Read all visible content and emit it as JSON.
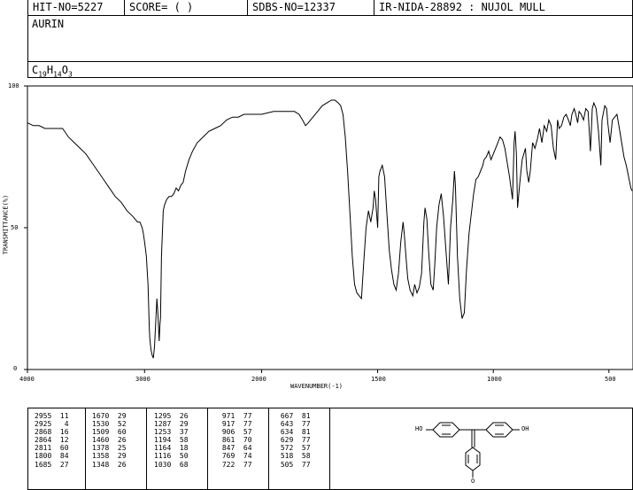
{
  "header": {
    "hit_no": "HIT-NO=5227",
    "score": "SCORE=  (  )",
    "sdbs_no": "SDBS-NO=12337",
    "ir_nida": "IR-NIDA-28892 : NUJOL MULL"
  },
  "compound_name": "AURIN",
  "formula": {
    "c": "C",
    "c_n": "19",
    "h": "H",
    "h_n": "14",
    "o": "O",
    "o_n": "3"
  },
  "chart_data": {
    "type": "line",
    "xlabel": "WAVENUMBER(-1)",
    "ylabel": "TRANSMITTANCE(%)",
    "xlim": [
      4000,
      400
    ],
    "ylim": [
      0,
      100
    ],
    "x_ticks": [
      "4000",
      "3000",
      "2000",
      "1500",
      "1000",
      "500"
    ],
    "y_ticks": [
      "100",
      "50",
      "0"
    ],
    "series": [
      {
        "x": [
          4000,
          3950,
          3900,
          3850,
          3800,
          3750,
          3700,
          3650,
          3600,
          3550,
          3500,
          3450,
          3400,
          3350,
          3300,
          3250,
          3200,
          3150,
          3100,
          3080,
          3060,
          3040,
          3030,
          3020,
          3010,
          3000,
          2985,
          2970,
          2960,
          2955,
          2945,
          2935,
          2925,
          2915,
          2905,
          2895,
          2885,
          2875,
          2868,
          2864,
          2855,
          2840,
          2830,
          2811,
          2790,
          2770,
          2750,
          2730,
          2710,
          2690,
          2670,
          2650,
          2620,
          2590,
          2550,
          2500,
          2450,
          2400,
          2350,
          2300,
          2250,
          2200,
          2150,
          2100,
          2050,
          2000,
          1950,
          1900,
          1860,
          1840,
          1825,
          1812,
          1800,
          1780,
          1760,
          1740,
          1720,
          1700,
          1685,
          1670,
          1660,
          1650,
          1640,
          1630,
          1620,
          1610,
          1600,
          1590,
          1580,
          1570,
          1560,
          1550,
          1540,
          1530,
          1520,
          1515,
          1509,
          1500,
          1495,
          1490,
          1480,
          1470,
          1460,
          1450,
          1440,
          1430,
          1420,
          1410,
          1400,
          1390,
          1385,
          1378,
          1370,
          1360,
          1348,
          1340,
          1330,
          1320,
          1310,
          1300,
          1295,
          1287,
          1280,
          1270,
          1260,
          1253,
          1245,
          1235,
          1225,
          1215,
          1205,
          1194,
          1185,
          1175,
          1168,
          1164,
          1155,
          1145,
          1135,
          1125,
          1116,
          1105,
          1095,
          1085,
          1075,
          1065,
          1055,
          1045,
          1040,
          1030,
          1020,
          1010,
          1000,
          990,
          980,
          971,
          960,
          950,
          940,
          930,
          917,
          910,
          906,
          900,
          895,
          885,
          875,
          861,
          855,
          847,
          840,
          830,
          820,
          810,
          800,
          790,
          780,
          769,
          760,
          750,
          740,
          730,
          722,
          715,
          705,
          695,
          685,
          675,
          667,
          660,
          650,
          643,
          635,
          629,
          620,
          610,
          600,
          590,
          580,
          575,
          572,
          565,
          555,
          545,
          535,
          530,
          518,
          510,
          505,
          495,
          485,
          475,
          465,
          455,
          445,
          435,
          425,
          415,
          405,
          400
        ],
        "y": [
          87,
          86,
          86,
          85,
          85,
          85,
          85,
          82,
          80,
          78,
          76,
          73,
          70,
          67,
          64,
          61,
          59,
          56,
          54,
          53,
          52,
          52,
          51,
          50,
          48,
          45,
          40,
          30,
          15,
          11,
          7,
          5,
          4,
          8,
          16,
          25,
          19,
          10,
          16,
          18,
          40,
          56,
          58,
          60,
          61,
          61,
          62,
          64,
          63,
          65,
          66,
          70,
          74,
          77,
          80,
          82,
          84,
          85,
          86,
          88,
          89,
          89,
          90,
          90,
          90,
          90,
          91,
          91,
          91,
          90,
          88,
          86,
          87,
          89,
          91,
          93,
          94,
          95,
          95,
          94,
          93,
          90,
          82,
          70,
          55,
          40,
          30,
          27,
          26,
          25,
          38,
          50,
          56,
          52,
          57,
          63,
          60,
          50,
          68,
          70,
          72,
          68,
          55,
          42,
          35,
          30,
          28,
          34,
          45,
          52,
          48,
          40,
          32,
          28,
          26,
          30,
          27,
          29,
          34,
          52,
          57,
          53,
          42,
          30,
          28,
          37,
          50,
          58,
          62,
          54,
          42,
          30,
          50,
          60,
          70,
          65,
          40,
          25,
          18,
          20,
          35,
          48,
          55,
          62,
          67,
          68,
          70,
          72,
          74,
          75,
          77,
          74,
          76,
          78,
          80,
          82,
          81,
          78,
          73,
          68,
          60,
          80,
          84,
          76,
          57,
          66,
          74,
          78,
          70,
          66,
          70,
          80,
          78,
          81,
          85,
          80,
          86,
          84,
          88,
          86,
          78,
          74,
          88,
          85,
          86,
          89,
          90,
          88,
          86,
          90,
          92,
          90,
          87,
          91,
          90,
          88,
          92,
          91,
          77,
          86,
          92,
          94,
          92,
          84,
          72,
          88,
          93,
          92,
          87,
          80,
          88,
          89,
          90,
          85,
          80,
          75,
          72,
          68,
          64,
          63
        ]
      }
    ]
  },
  "peak_table": {
    "col1": [
      [
        "2955",
        "11"
      ],
      [
        "2925",
        "4"
      ],
      [
        "2868",
        "16"
      ],
      [
        "2864",
        "12"
      ],
      [
        "2811",
        "60"
      ],
      [
        "1800",
        "84"
      ],
      [
        "1685",
        "27"
      ]
    ],
    "col2": [
      [
        "1670",
        "29"
      ],
      [
        "1530",
        "52"
      ],
      [
        "1509",
        "60"
      ],
      [
        "1460",
        "26"
      ],
      [
        "1378",
        "25"
      ],
      [
        "1358",
        "29"
      ],
      [
        "1348",
        "26"
      ]
    ],
    "col3": [
      [
        "1295",
        "26"
      ],
      [
        "1287",
        "29"
      ],
      [
        "1253",
        "37"
      ],
      [
        "1194",
        "58"
      ],
      [
        "1164",
        "18"
      ],
      [
        "1116",
        "50"
      ],
      [
        "1030",
        "68"
      ]
    ],
    "col4": [
      [
        "971",
        "77"
      ],
      [
        "917",
        "77"
      ],
      [
        "906",
        "57"
      ],
      [
        "861",
        "70"
      ],
      [
        "847",
        "64"
      ],
      [
        "769",
        "74"
      ],
      [
        "722",
        "77"
      ]
    ],
    "col5": [
      [
        "667",
        "81"
      ],
      [
        "643",
        "77"
      ],
      [
        "634",
        "81"
      ],
      [
        "629",
        "77"
      ],
      [
        "572",
        "57"
      ],
      [
        "518",
        "58"
      ],
      [
        "505",
        "77"
      ]
    ]
  },
  "structure_labels": {
    "left_oh": "HO",
    "right_oh": "OH",
    "ketone": "O"
  }
}
